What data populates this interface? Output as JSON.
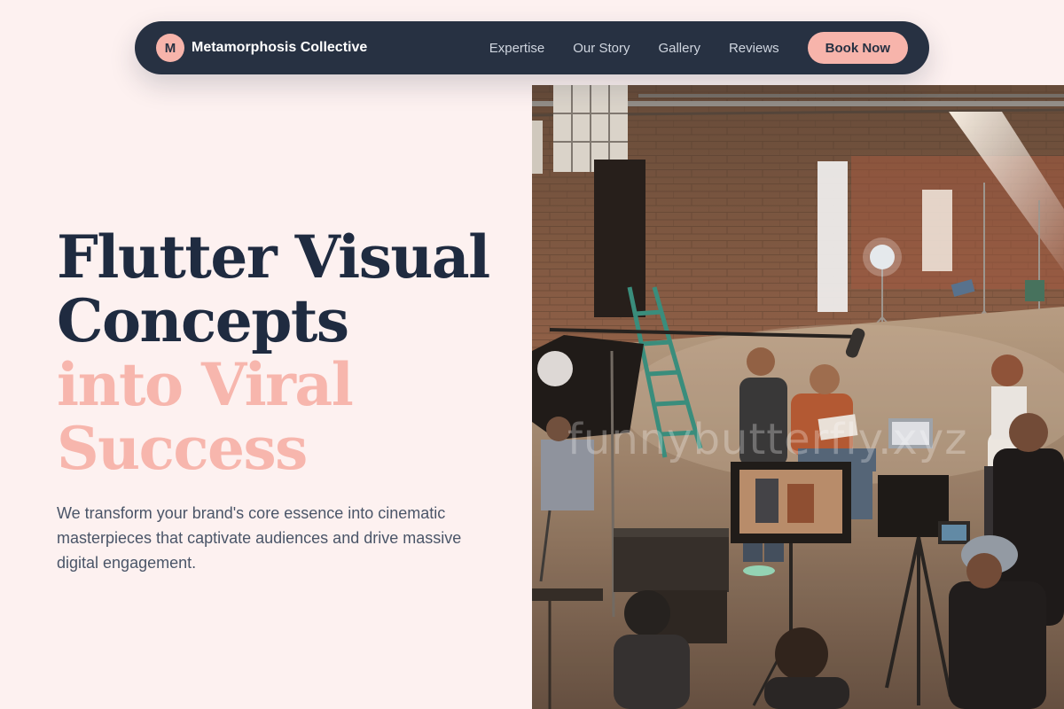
{
  "nav": {
    "brand_initial": "M",
    "brand_name": "Metamorphosis Collective",
    "links": [
      "Expertise",
      "Our Story",
      "Gallery",
      "Reviews"
    ],
    "cta": "Book Now"
  },
  "hero": {
    "title_lines": [
      "Flutter Visual",
      "Concepts",
      "into Viral",
      "Success"
    ],
    "subtitle": "We transform your brand's core essence into cinematic masterpieces that captivate audiences and drive massive digital engagement.",
    "image_watermark": "funnybutterfly.xyz"
  },
  "colors": {
    "background": "#fdf1f0",
    "navy": "#273142",
    "accent_pink": "#f7b4ab",
    "heading_dark": "#1f2b40"
  }
}
